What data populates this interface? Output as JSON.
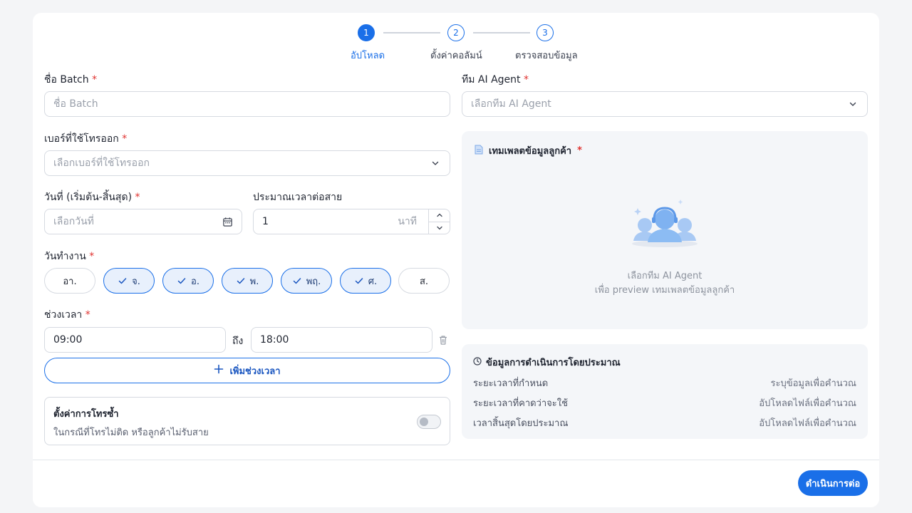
{
  "stepper": {
    "steps": [
      {
        "number": "1",
        "label": "อัปโหลด"
      },
      {
        "number": "2",
        "label": "ตั้งค่าคอลัมน์"
      },
      {
        "number": "3",
        "label": "ตรวจสอบข้อมูล"
      }
    ],
    "active_step": 1
  },
  "form": {
    "batch_name": {
      "label": "ชื่อ Batch",
      "required": "*",
      "placeholder": "ชื่อ Batch",
      "value": ""
    },
    "ai_team": {
      "label": "ทีม AI Agent",
      "required": "*",
      "placeholder": "เลือกทีม AI Agent"
    },
    "caller_number": {
      "label": "เบอร์ที่ใช้โทรออก",
      "required": "*",
      "placeholder": "เลือกเบอร์ที่ใช้โทรออก"
    },
    "date_range": {
      "label": "วันที่ (เริ่มต้น-สิ้นสุด)",
      "required": "*",
      "placeholder": "เลือกวันที่"
    },
    "est_time": {
      "label": "ประมาณเวลาต่อสาย",
      "value": "1",
      "unit": "นาที"
    },
    "work_days": {
      "label": "วันทำงาน",
      "required": "*",
      "days": [
        {
          "label": "อา.",
          "selected": false
        },
        {
          "label": "จ.",
          "selected": true
        },
        {
          "label": "อ.",
          "selected": true
        },
        {
          "label": "พ.",
          "selected": true
        },
        {
          "label": "พฤ.",
          "selected": true
        },
        {
          "label": "ศ.",
          "selected": true
        },
        {
          "label": "ส.",
          "selected": false
        }
      ]
    },
    "time_range": {
      "label": "ช่วงเวลา",
      "required": "*",
      "start": "09:00",
      "to_label": "ถึง",
      "end": "18:00"
    },
    "add_time_label": "เพิ่มช่วงเวลา",
    "retry": {
      "title": "ตั้งค่าการโทรซ้ำ",
      "description": "ในกรณีที่โทรไม่ติด หรือลูกค้าไม่รับสาย",
      "enabled": false
    }
  },
  "template_panel": {
    "title": "เทมเพลตข้อมูลลูกค้า",
    "required": "*",
    "empty_line1": "เลือกทีม AI Agent",
    "empty_line2": "เพื่อ preview เทมเพลตข้อมูลลูกค้า"
  },
  "estimate_panel": {
    "title": "ข้อมูลการดำเนินการโดยประมาณ",
    "rows": [
      {
        "label": "ระยะเวลาที่กำหนด",
        "value": "ระบุข้อมูลเพื่อคำนวณ"
      },
      {
        "label": "ระยะเวลาที่คาดว่าจะใช้",
        "value": "อัปโหลดไฟล์เพื่อคำนวณ"
      },
      {
        "label": "เวลาสิ้นสุดโดยประมาณ",
        "value": "อัปโหลดไฟล์เพื่อคำนวณ"
      }
    ]
  },
  "footer": {
    "continue_label": "ดำเนินการต่อ"
  },
  "colors": {
    "accent": "#1a6fe8",
    "required": "#e0322f",
    "panel": "#f4f6f9"
  }
}
